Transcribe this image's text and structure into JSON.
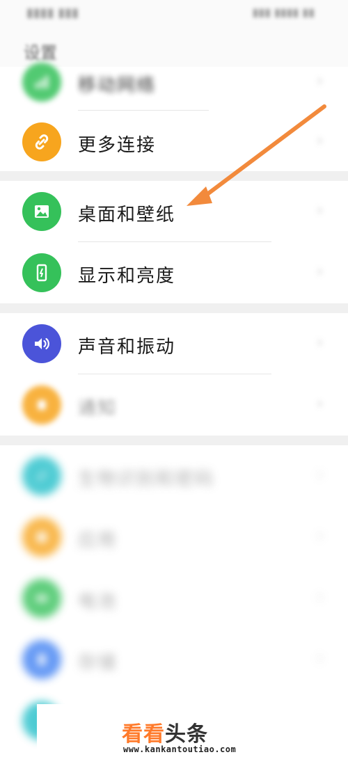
{
  "status_bar": {
    "left": "(blurred)",
    "right": "(blurred)"
  },
  "page": {
    "title": "设置"
  },
  "settings": [
    {
      "label": "移动网络",
      "color": "#35c15a",
      "icon": "mobile-network-icon"
    },
    {
      "label": "更多连接",
      "color": "#f7a51e",
      "icon": "link-icon"
    },
    {
      "label": "桌面和壁纸",
      "color": "#35c15a",
      "icon": "image-icon"
    },
    {
      "label": "显示和亮度",
      "color": "#35c15a",
      "icon": "phone-brightness-icon"
    },
    {
      "label": "声音和振动",
      "color": "#4b54d9",
      "icon": "speaker-icon"
    },
    {
      "label": "通知",
      "color": "#f7a51e",
      "icon": "bell-icon"
    },
    {
      "label": "生物识别和密码",
      "color": "#23bfc9",
      "icon": "key-icon"
    },
    {
      "label": "应用",
      "color": "#f7a51e",
      "icon": "apps-icon"
    },
    {
      "label": "电池",
      "color": "#35c15a",
      "icon": "battery-icon"
    },
    {
      "label": "存储",
      "color": "#3f80f2",
      "icon": "storage-icon"
    },
    {
      "label": "",
      "color": "#23bfc9",
      "icon": "unknown-icon"
    }
  ],
  "chevron": "›",
  "annotation": {
    "color": "#f28a3c"
  },
  "watermark": {
    "title_orange": "看看",
    "title_dark": "头条",
    "url": "www.kankantoutiao.com"
  }
}
